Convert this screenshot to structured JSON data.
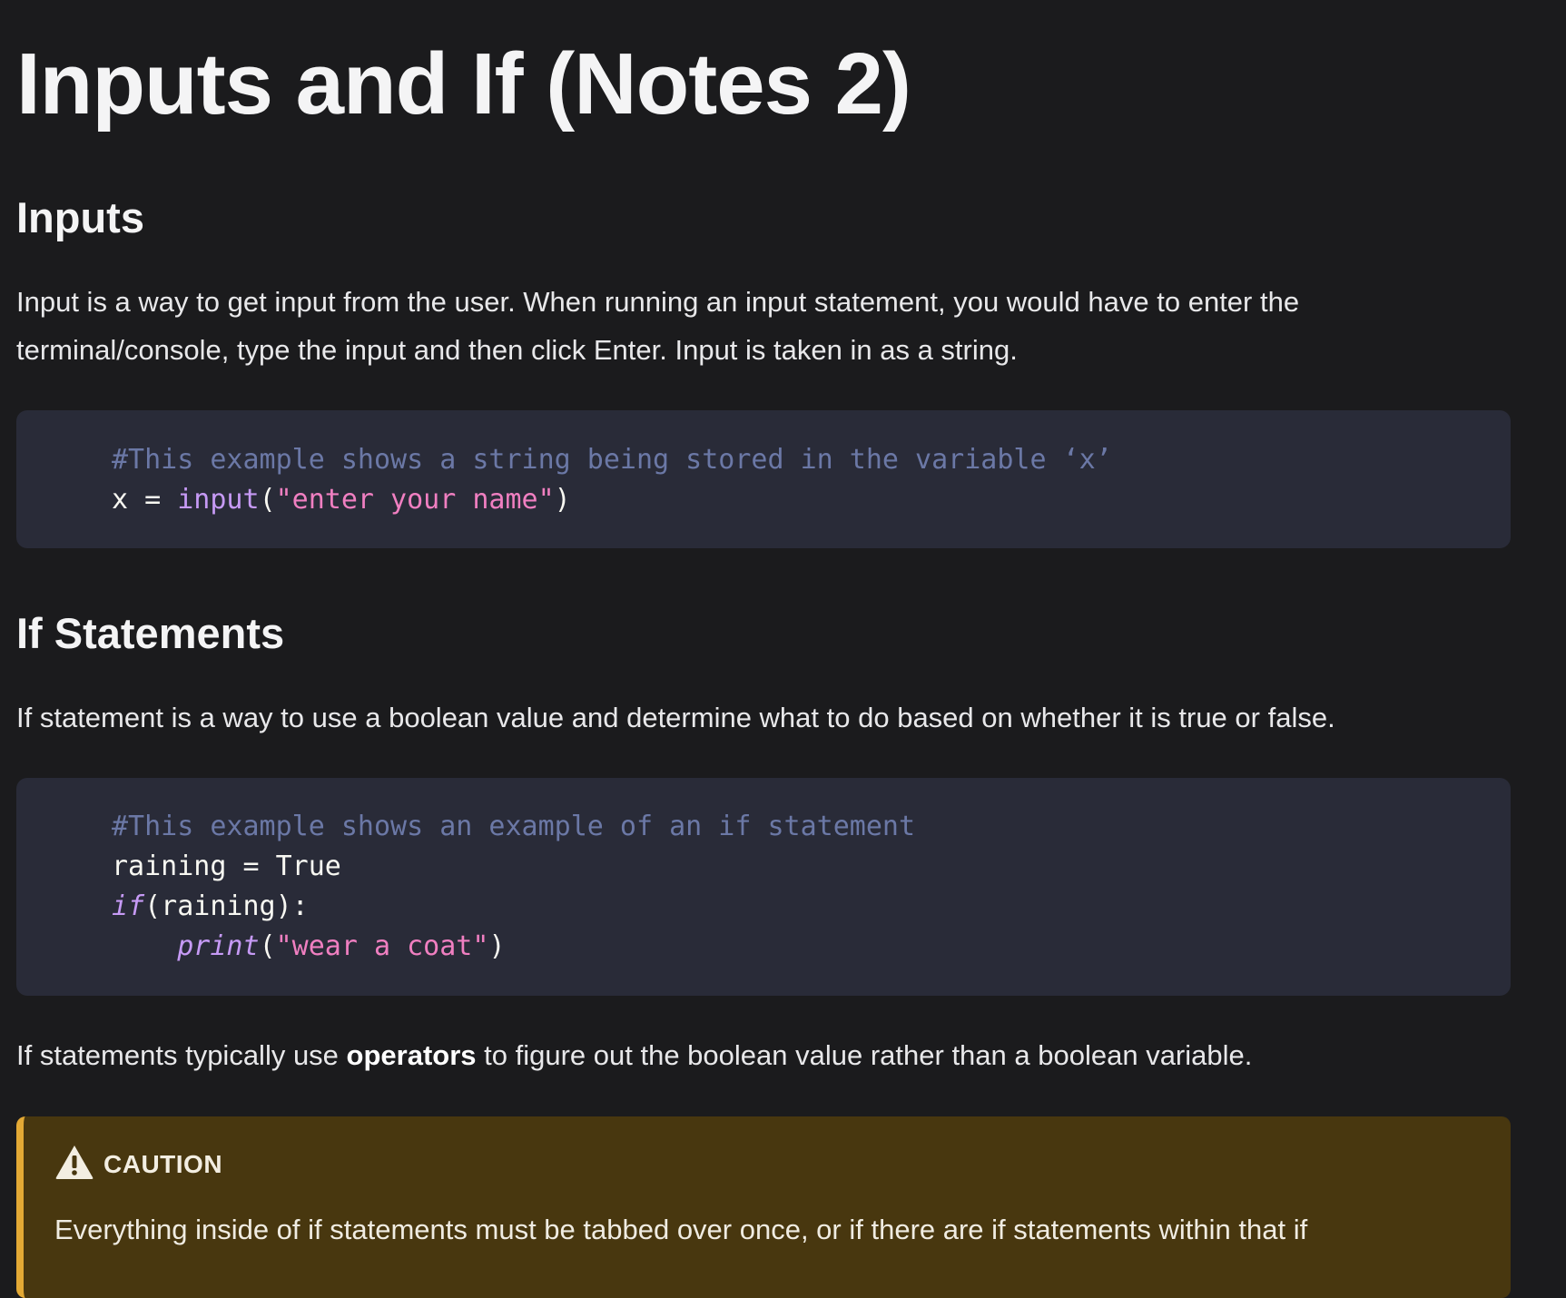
{
  "page": {
    "title": "Inputs and If (Notes 2)"
  },
  "inputs_section": {
    "heading": "Inputs",
    "paragraph_line1": "Input is a way to get input from the user. When running an input statement, you would have to enter the",
    "paragraph_line2": "terminal/console, type the input and then click Enter. Input is taken in as a string.",
    "code": {
      "comment": "#This example shows a string being stored in the variable ‘x’",
      "assign": "x = ",
      "func": "input",
      "open_paren": "(",
      "string": "\"enter your name\"",
      "close_paren": ")"
    }
  },
  "if_section": {
    "heading": "If Statements",
    "paragraph": "If statement is a way to use a boolean value and determine what to do based on whether it is true or false.",
    "code": {
      "comment": "#This example shows an example of an if statement",
      "line2": "raining = True",
      "keyword": "if",
      "line3_rest": "(raining):",
      "indent": "    ",
      "func": "print",
      "open_paren": "(",
      "string": "\"wear a coat\"",
      "close_paren": ")"
    },
    "operators_prefix": "If statements typically use ",
    "operators_bold": "operators",
    "operators_suffix": " to figure out the boolean value rather than a boolean variable."
  },
  "caution": {
    "icon": "warning-triangle-icon",
    "title": "CAUTION",
    "body": "Everything inside of if statements must be tabbed over once, or if there are if statements within that if",
    "accent_color": "#e3a935",
    "background_color": "#48370f"
  }
}
